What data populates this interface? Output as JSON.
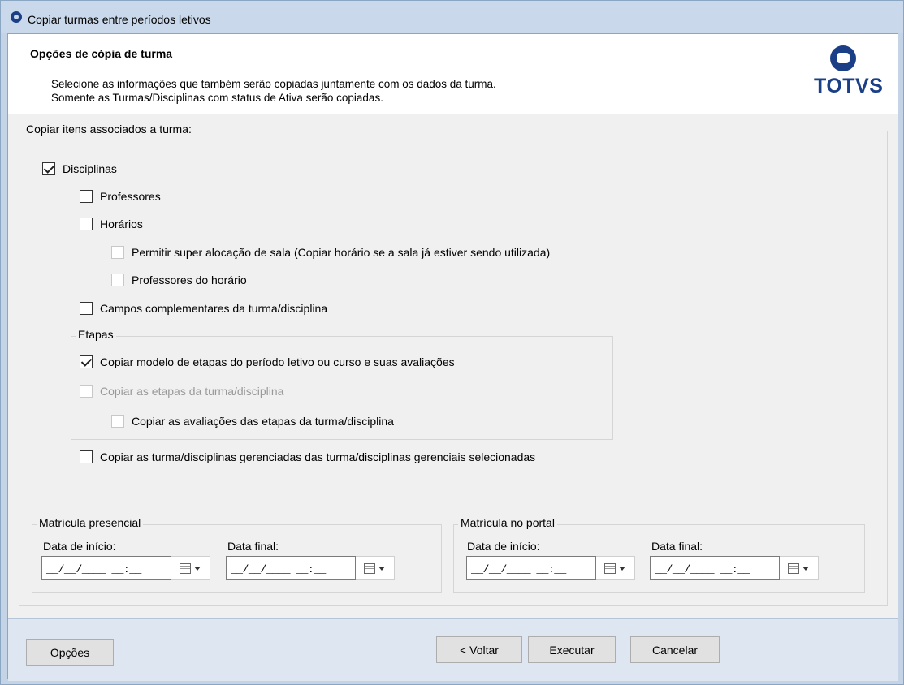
{
  "window": {
    "title": "Copiar turmas entre períodos letivos"
  },
  "header": {
    "title": "Opções de cópia de turma",
    "desc_line1": "Selecione as informações que também serão copiadas juntamente com os dados da turma.",
    "desc_line2": "Somente as Turmas/Disciplinas com status de Ativa serão copiadas.",
    "logo_text": "TOTVS"
  },
  "items_group": {
    "label": "Copiar itens associados a turma:"
  },
  "checkboxes": {
    "disciplinas": {
      "label": "Disciplinas",
      "checked": true,
      "enabled": true
    },
    "professores": {
      "label": "Professores",
      "checked": false,
      "enabled": true
    },
    "horarios": {
      "label": "Horários",
      "checked": false,
      "enabled": true
    },
    "super_alocacao": {
      "label": "Permitir super alocação de sala (Copiar horário se a sala já estiver sendo utilizada)",
      "checked": false,
      "enabled": false
    },
    "professores_horario": {
      "label": "Professores do horário",
      "checked": false,
      "enabled": false
    },
    "campos_complementares": {
      "label": "Campos complementares da turma/disciplina",
      "checked": false,
      "enabled": true
    },
    "modelo_etapas": {
      "label": "Copiar modelo de etapas do período letivo ou curso e suas avaliações",
      "checked": true,
      "enabled": true
    },
    "etapas_turma": {
      "label": "Copiar as etapas da turma/disciplina",
      "checked": false,
      "enabled": false
    },
    "avaliacoes_etapas": {
      "label": "Copiar as avaliações das etapas da turma/disciplina",
      "checked": false,
      "enabled": false
    },
    "gerenciadas": {
      "label": "Copiar as turma/disciplinas gerenciadas das turma/disciplinas gerenciais selecionadas",
      "checked": false,
      "enabled": true
    }
  },
  "etapas_group": {
    "label": "Etapas"
  },
  "matricula_presencial": {
    "label": "Matrícula presencial",
    "start_label": "Data de início:",
    "start_value": "__/__/____ __:__",
    "end_label": "Data final:",
    "end_value": "__/__/____ __:__"
  },
  "matricula_portal": {
    "label": "Matrícula no portal",
    "start_label": "Data de início:",
    "start_value": "__/__/____ __:__",
    "end_label": "Data final:",
    "end_value": "__/__/____ __:__"
  },
  "footer": {
    "options_button": "Opções",
    "back_button": "< Voltar",
    "execute_button": "Executar",
    "cancel_button": "Cancelar"
  },
  "colors": {
    "brand": "#1b3f86",
    "title_bar": "#c9d8ea",
    "footer": "#dde6f1"
  }
}
